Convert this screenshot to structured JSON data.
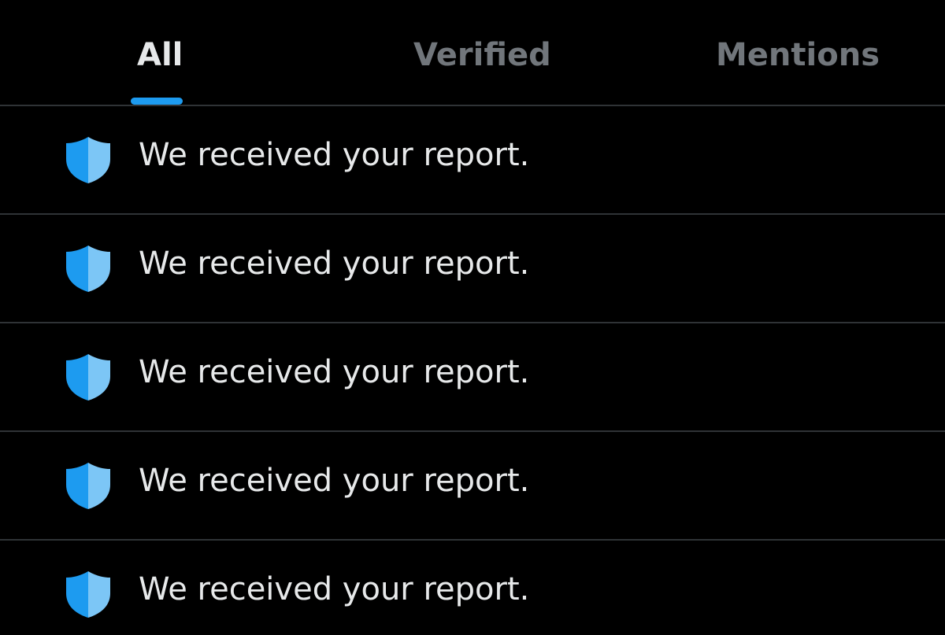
{
  "tabs": [
    {
      "label": "All",
      "active": true
    },
    {
      "label": "Verified",
      "active": false
    },
    {
      "label": "Mentions",
      "active": false
    }
  ],
  "notifications": [
    {
      "icon": "shield-icon",
      "text": "We received your report."
    },
    {
      "icon": "shield-icon",
      "text": "We received your report."
    },
    {
      "icon": "shield-icon",
      "text": "We received your report."
    },
    {
      "icon": "shield-icon",
      "text": "We received your report."
    },
    {
      "icon": "shield-icon",
      "text": "We received your report."
    }
  ],
  "colors": {
    "background": "#000000",
    "accent": "#1d9bf0",
    "shield_dark": "#1d9bf0",
    "shield_light": "#7cc6f6",
    "active_tab_text": "#e7e9ea",
    "inactive_tab_text": "#71767b",
    "divider": "#2f3336"
  }
}
